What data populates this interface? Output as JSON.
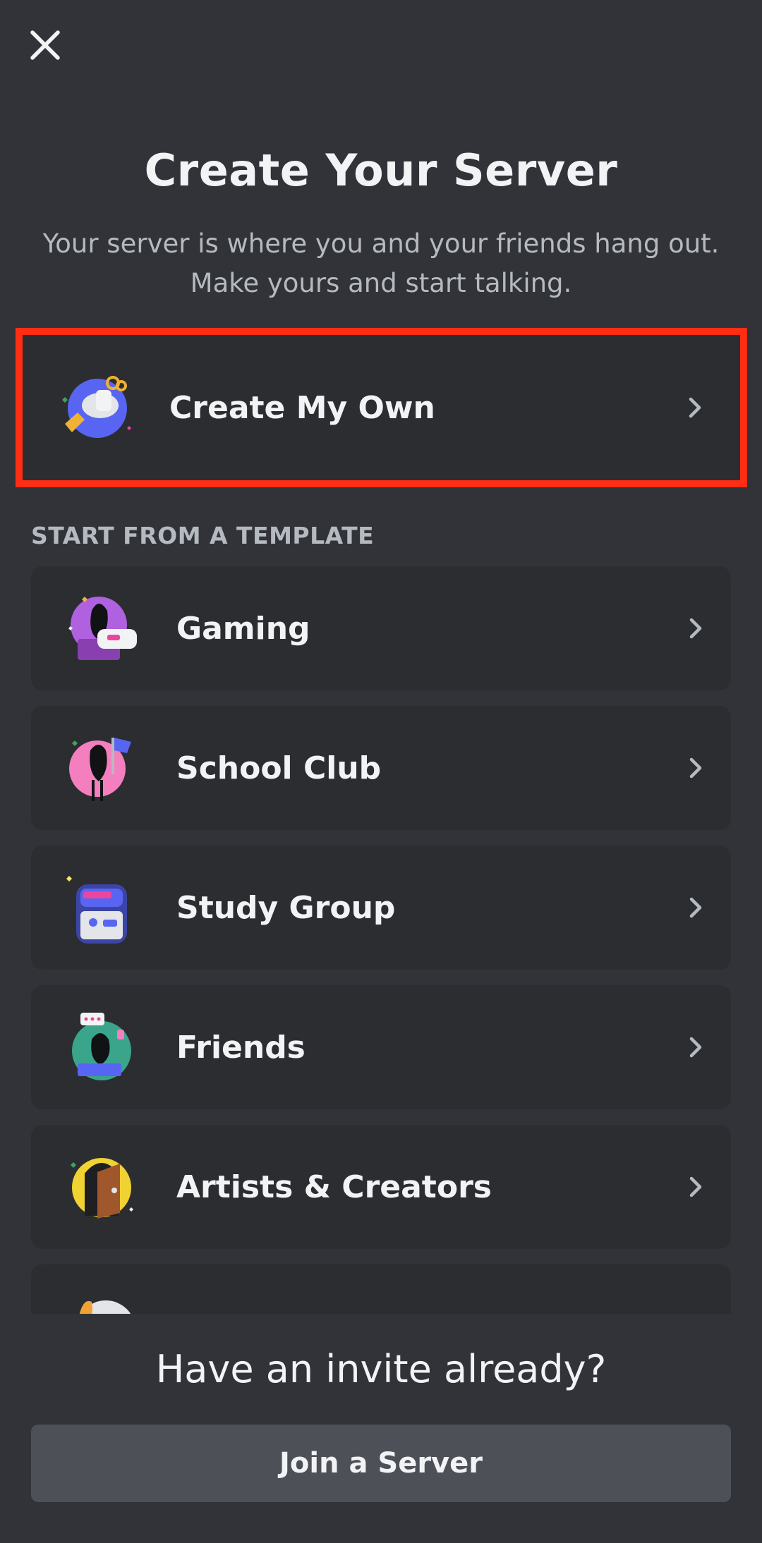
{
  "header": {
    "close_icon": "close-icon",
    "title": "Create Your Server",
    "subtitle": "Your server is where you and your friends hang out. Make yours and start talking."
  },
  "create_own": {
    "label": "Create My Own",
    "icon": "create-server-illustration-icon",
    "highlight_color": "#ff2d14"
  },
  "templates": {
    "section_label": "START FROM A TEMPLATE",
    "items": [
      {
        "label": "Gaming",
        "icon": "gaming-illustration-icon"
      },
      {
        "label": "School Club",
        "icon": "school-club-illustration-icon"
      },
      {
        "label": "Study Group",
        "icon": "study-group-illustration-icon"
      },
      {
        "label": "Friends",
        "icon": "friends-illustration-icon"
      },
      {
        "label": "Artists & Creators",
        "icon": "artists-creators-illustration-icon"
      },
      {
        "label": "",
        "icon": "local-community-illustration-icon"
      }
    ]
  },
  "invite": {
    "heading": "Have an invite already?",
    "join_button": "Join a Server"
  },
  "colors": {
    "background": "#313338",
    "card": "#2b2d31",
    "secondary_text": "#b5bac1",
    "button": "#4e5058"
  }
}
